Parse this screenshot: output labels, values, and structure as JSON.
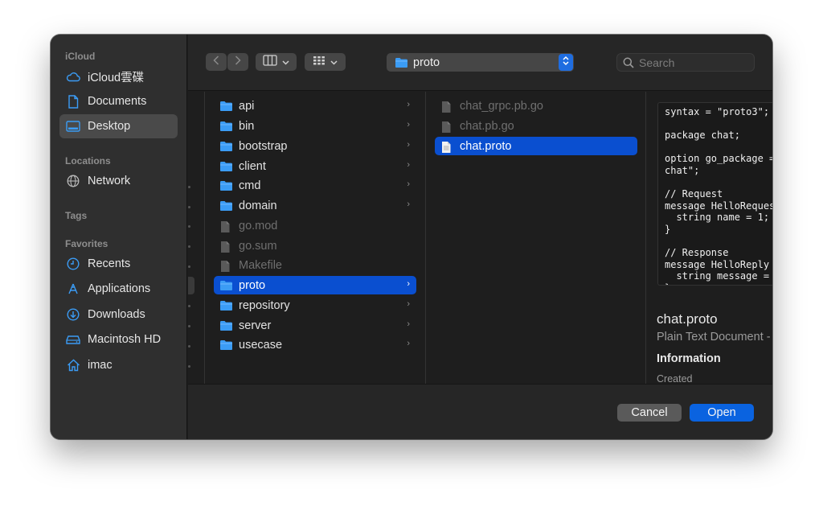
{
  "sidebar": {
    "sections": [
      {
        "heading": "iCloud",
        "items": [
          {
            "label": "iCloud雲碟",
            "icon": "cloud-icon"
          },
          {
            "label": "Documents",
            "icon": "document-icon"
          },
          {
            "label": "Desktop",
            "icon": "desktop-icon",
            "selected": true
          }
        ]
      },
      {
        "heading": "Locations",
        "items": [
          {
            "label": "Network",
            "icon": "globe-icon"
          }
        ]
      },
      {
        "heading": "Tags",
        "items": []
      },
      {
        "heading": "Favorites",
        "items": [
          {
            "label": "Recents",
            "icon": "clock-icon"
          },
          {
            "label": "Applications",
            "icon": "applications-icon"
          },
          {
            "label": "Downloads",
            "icon": "download-icon"
          },
          {
            "label": "Macintosh HD",
            "icon": "hard-drive-icon"
          },
          {
            "label": "imac",
            "icon": "home-icon"
          }
        ]
      }
    ]
  },
  "toolbar": {
    "path_label": "proto",
    "search_placeholder": "Search"
  },
  "column1": [
    {
      "name": "api",
      "kind": "folder"
    },
    {
      "name": "bin",
      "kind": "folder"
    },
    {
      "name": "bootstrap",
      "kind": "folder"
    },
    {
      "name": "client",
      "kind": "folder"
    },
    {
      "name": "cmd",
      "kind": "folder"
    },
    {
      "name": "domain",
      "kind": "folder"
    },
    {
      "name": "go.mod",
      "kind": "file",
      "dimmed": true
    },
    {
      "name": "go.sum",
      "kind": "file",
      "dimmed": true
    },
    {
      "name": "Makefile",
      "kind": "file",
      "dimmed": true
    },
    {
      "name": "proto",
      "kind": "folder",
      "selected": true
    },
    {
      "name": "repository",
      "kind": "folder"
    },
    {
      "name": "server",
      "kind": "folder"
    },
    {
      "name": "usecase",
      "kind": "folder"
    }
  ],
  "column2": [
    {
      "name": "chat_grpc.pb.go",
      "kind": "file",
      "dimmed": true
    },
    {
      "name": "chat.pb.go",
      "kind": "file",
      "dimmed": true
    },
    {
      "name": "chat.proto",
      "kind": "file",
      "selected": true
    }
  ],
  "preview": {
    "code_lines": [
      "syntax = \"proto3\";",
      "",
      "package chat;",
      "",
      "option go_package =",
      "chat\";",
      "",
      "// Request",
      "message HelloReques",
      "  string name = 1;",
      "}",
      "",
      "// Response",
      "message HelloReply",
      "  string message =",
      "}"
    ],
    "title": "chat.proto",
    "subtitle": "Plain Text Document -",
    "info_heading": "Information",
    "created_label": "Created"
  },
  "footer": {
    "cancel_label": "Cancel",
    "open_label": "Open"
  },
  "colors": {
    "accent": "#0a63e0",
    "selection": "#0a4fd0",
    "folder": "#3b9cf5",
    "sidebar_bg": "#2f2f2f",
    "window_bg": "#1e1e1e"
  }
}
